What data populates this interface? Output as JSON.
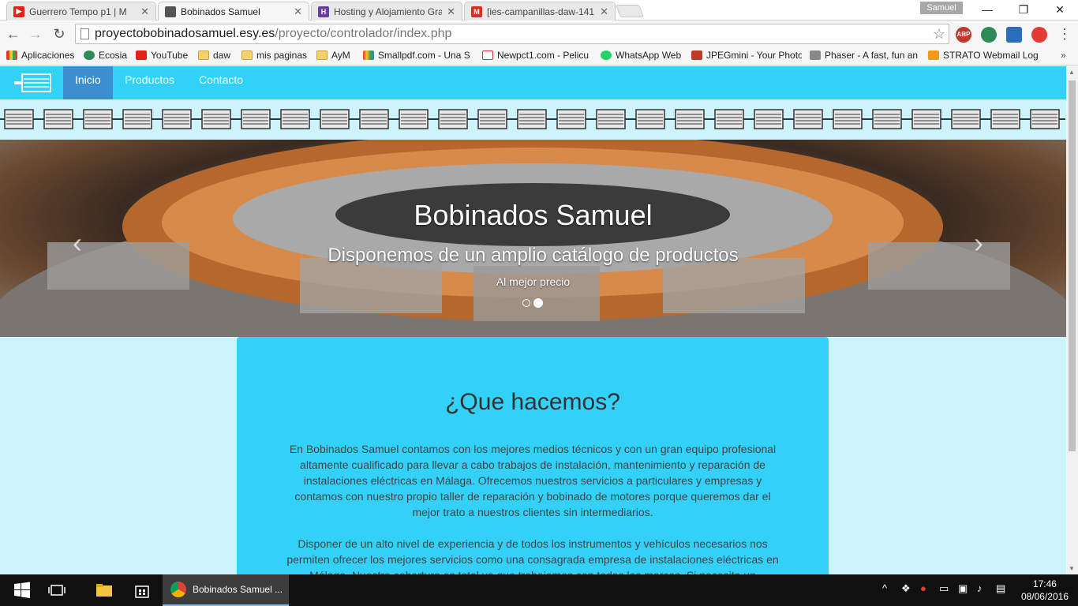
{
  "browser": {
    "tabs": [
      {
        "label": "Guerrero Tempo p1 | M",
        "active": false
      },
      {
        "label": "Bobinados Samuel",
        "active": true
      },
      {
        "label": "Hosting y Alojamiento Gra",
        "active": false
      },
      {
        "label": "[ies-campanillas-daw-141",
        "active": false
      }
    ],
    "profile_name": "Samuel",
    "url_host": "proyectobobinadosamuel.esy.es",
    "url_path": "/proyecto/controlador/index.php",
    "extensions": [
      "ABP"
    ],
    "bookmarks": [
      "Aplicaciones",
      "Ecosia",
      "YouTube",
      "daw",
      "mis paginas",
      "AyM",
      "Smallpdf.com - Una S",
      "Newpct1.com - Pelicu",
      "WhatsApp Web",
      "JPEGmini - Your Photo",
      "Phaser - A fast, fun an",
      "STRATO Webmail Log"
    ]
  },
  "site": {
    "nav": [
      "Inicio",
      "Productos",
      "Contacto"
    ],
    "carousel": {
      "title": "Bobinados Samuel",
      "subtitle": "Disponemos de un amplio catálogo de productos",
      "caption": "Al mejor precio",
      "prev_icon": "‹",
      "next_icon": "›",
      "slide_count": 2,
      "active_slide": 2
    },
    "section": {
      "heading": "¿Que hacemos?",
      "paragraph1": "En Bobinados Samuel contamos con los mejores medios técnicos y con un gran equipo profesional altamente cualificado para llevar a cabo trabajos de instalación, mantenimiento y reparación de instalaciones eléctricas en Málaga. Ofrecemos nuestros servicios a particulares y empresas y contamos con nuestro propio taller de reparación y bobinado de motores porque queremos dar el mejor trato a nuestros clientes sin intermediarios.",
      "paragraph2": "Disponer de un alto nivel de experiencia y de todos los instrumentos y vehículos necesarios nos permiten ofrecer los mejores servicios como una consagrada empresa de instalaciones eléctricas en Málaga. Nuestra cobertura es total ya que trabajamos con todas las marcas. Si necesita un"
    },
    "colors": {
      "navbar": "#33d0f8",
      "page_bg": "#cdf4fd",
      "active_nav": "#3b8fd1"
    }
  },
  "taskbar": {
    "app_label": "Bobinados Samuel ...",
    "time": "17:46",
    "date": "08/06/2016"
  }
}
